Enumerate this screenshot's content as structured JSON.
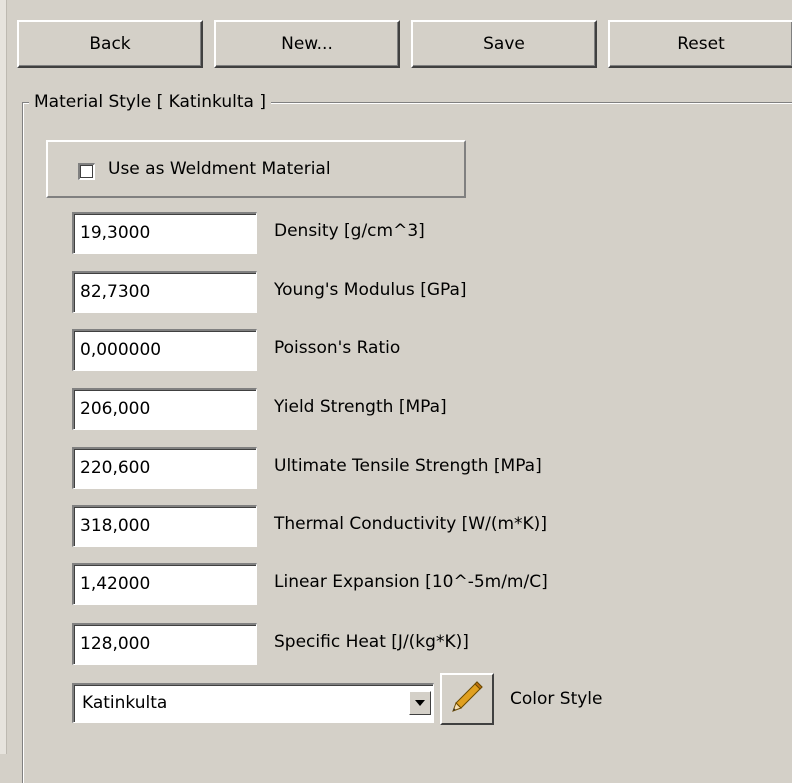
{
  "toolbar": {
    "back_label": "Back",
    "new_label": "New...",
    "save_label": "Save",
    "reset_label": "Reset"
  },
  "group": {
    "title": "Material Style [ Katinkulta ]"
  },
  "weldment": {
    "label": "Use as Weldment Material",
    "checked": false
  },
  "fields": [
    {
      "value": "19,3000",
      "label": "Density  [g/cm^3]"
    },
    {
      "value": "82,7300",
      "label": "Young's Modulus  [GPa]"
    },
    {
      "value": "0,000000",
      "label": "Poisson's Ratio"
    },
    {
      "value": "206,000",
      "label": "Yield Strength  [MPa]"
    },
    {
      "value": "220,600",
      "label": "Ultimate Tensile Strength  [MPa]"
    },
    {
      "value": "318,000",
      "label": "Thermal Conductivity  [W/(m*K)]"
    },
    {
      "value": "1,42000",
      "label": "Linear Expansion  [10^-5m/m/C]"
    },
    {
      "value": "128,000",
      "label": "Specific Heat [J/(kg*K)]"
    }
  ],
  "color_style": {
    "selected": "Katinkulta",
    "label": "Color Style",
    "dropdown_icon": "chevron-down-icon",
    "edit_icon": "pencil-icon"
  },
  "colors": {
    "background": "#d4d0c8",
    "field": "#ffffff",
    "pencil": "#e0a020"
  }
}
